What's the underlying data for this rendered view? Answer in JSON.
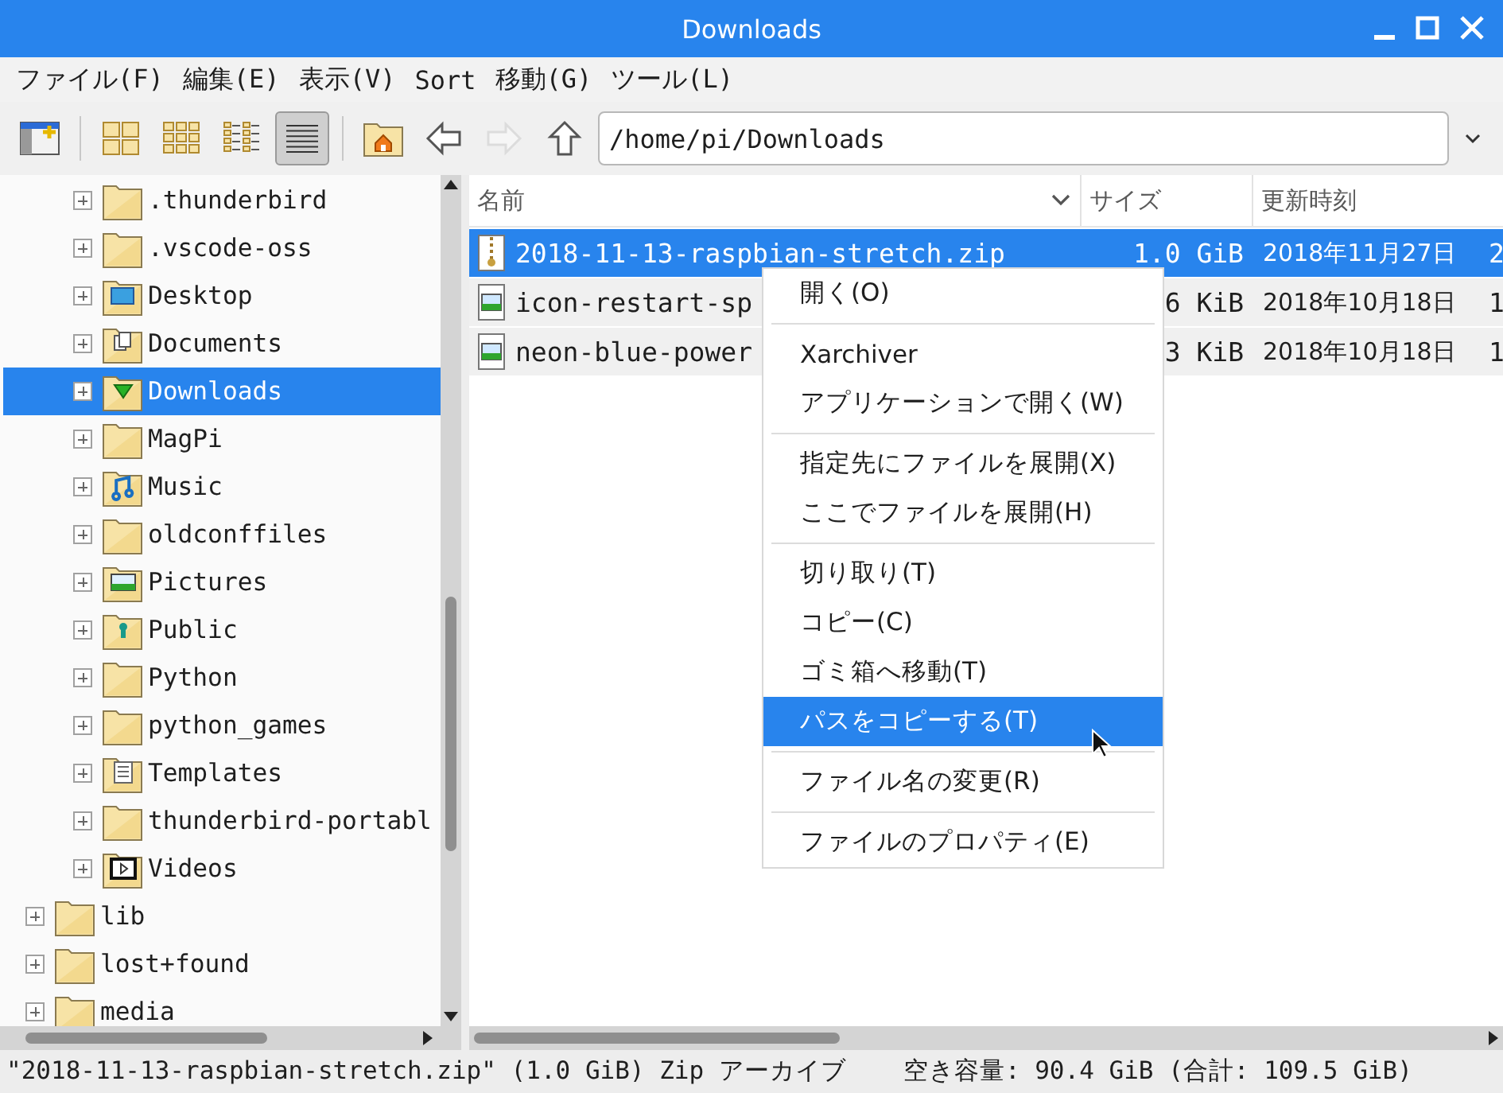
{
  "window": {
    "title": "Downloads"
  },
  "menu_bar": [
    "ファイル(F)",
    "編集(E)",
    "表示(V)",
    "Sort",
    "移動(G)",
    "ツール(L)"
  ],
  "toolbar": {
    "view_modes": [
      {
        "kind": "icons",
        "selected": false
      },
      {
        "kind": "thumbnails",
        "selected": false
      },
      {
        "kind": "compact",
        "selected": false
      },
      {
        "kind": "list",
        "selected": true
      }
    ],
    "nav": [
      {
        "kind": "home",
        "disabled": false
      },
      {
        "kind": "back",
        "disabled": false
      },
      {
        "kind": "forward",
        "disabled": true
      },
      {
        "kind": "up",
        "disabled": false
      }
    ],
    "path": "/home/pi/Downloads"
  },
  "tree": {
    "items": [
      {
        "children": [
          {
            "label": ".thunderbird",
            "kind": "plain",
            "selected": false
          },
          {
            "label": ".vscode-oss",
            "kind": "plain",
            "selected": false
          },
          {
            "label": "Desktop",
            "kind": "desktop",
            "selected": false
          },
          {
            "label": "Documents",
            "kind": "documents",
            "selected": false
          },
          {
            "label": "Downloads",
            "kind": "downloads",
            "selected": true
          },
          {
            "label": "MagPi",
            "kind": "plain",
            "selected": false
          },
          {
            "label": "Music",
            "kind": "music",
            "selected": false
          },
          {
            "label": "oldconffiles",
            "kind": "plain",
            "selected": false
          },
          {
            "label": "Pictures",
            "kind": "pictures",
            "selected": false
          },
          {
            "label": "Public",
            "kind": "public",
            "selected": false
          },
          {
            "label": "Python",
            "kind": "plain",
            "selected": false
          },
          {
            "label": "python_games",
            "kind": "plain",
            "selected": false
          },
          {
            "label": "Templates",
            "kind": "templates",
            "selected": false
          },
          {
            "label": "thunderbird-portabl",
            "kind": "plain",
            "selected": false
          },
          {
            "label": "Videos",
            "kind": "videos",
            "selected": false
          }
        ]
      },
      {
        "label": "lib",
        "kind": "plain",
        "selected": false
      },
      {
        "label": "lost+found",
        "kind": "plain",
        "selected": false
      },
      {
        "label": "media",
        "kind": "plain",
        "selected": false
      }
    ]
  },
  "file_list": {
    "columns": [
      "名前",
      "サイズ",
      "更新時刻"
    ],
    "rows": [
      {
        "kind": "archive",
        "name": "2018-11-13-raspbian-stretch.zip",
        "size": "1.0 GiB",
        "modified": "2018年11月27日",
        "column_4": "2",
        "selected": true
      },
      {
        "kind": "image",
        "name": "icon-restart-sp",
        "size": "6 KiB",
        "modified": "2018年10月18日",
        "column_4": "1",
        "selected": false
      },
      {
        "kind": "image",
        "name": "neon-blue-power",
        "size": "3 KiB",
        "modified": "2018年10月18日",
        "column_4": "1",
        "selected": false
      }
    ]
  },
  "context_menu": [
    {
      "kind": "item",
      "label": "開く(O)",
      "selected": false
    },
    {
      "kind": "separator"
    },
    {
      "kind": "item",
      "label": "Xarchiver",
      "selected": false
    },
    {
      "kind": "item",
      "label": "アプリケーションで開く(W)",
      "selected": false
    },
    {
      "kind": "separator"
    },
    {
      "kind": "item",
      "label": "指定先にファイルを展開(X)",
      "selected": false
    },
    {
      "kind": "item",
      "label": "ここでファイルを展開(H)",
      "selected": false
    },
    {
      "kind": "separator"
    },
    {
      "kind": "item",
      "label": "切り取り(T)",
      "selected": false
    },
    {
      "kind": "item",
      "label": "コピー(C)",
      "selected": false
    },
    {
      "kind": "item",
      "label": "ゴミ箱へ移動(T)",
      "selected": false
    },
    {
      "kind": "item",
      "label": "パスをコピーする(T)",
      "selected": true
    },
    {
      "kind": "separator"
    },
    {
      "kind": "item",
      "label": "ファイル名の変更(R)",
      "selected": false
    },
    {
      "kind": "separator"
    },
    {
      "kind": "item",
      "label": "ファイルのプロパティ(E)",
      "selected": false
    }
  ],
  "status_bar": {
    "selection": "\"2018-11-13-raspbian-stretch.zip\" (1.0 GiB) Zip アーカイブ",
    "free_space": "空き容量: 90.4 GiB (合計: 109.5 GiB)"
  }
}
